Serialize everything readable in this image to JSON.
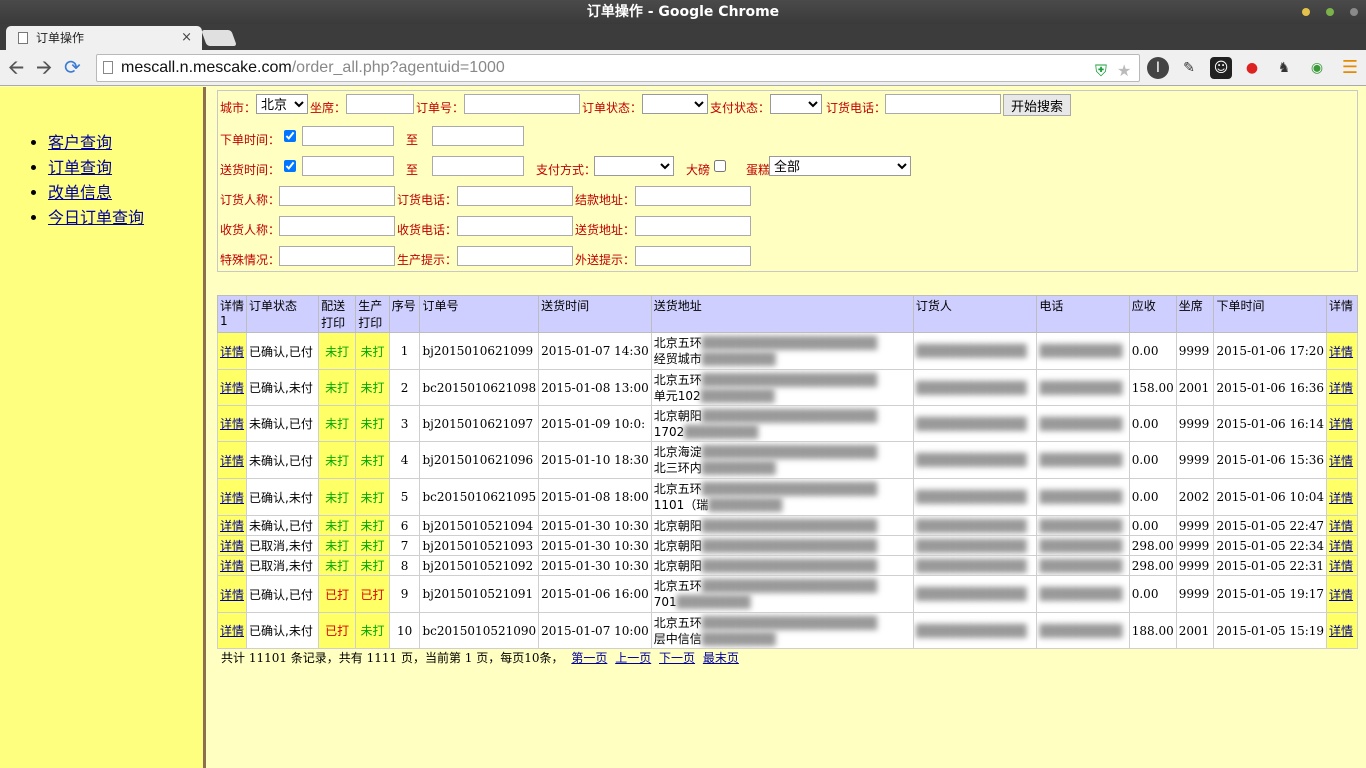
{
  "window": {
    "title": "订单操作 - Google Chrome"
  },
  "tab": {
    "title": "订单操作",
    "close": "×"
  },
  "address": {
    "host": "mescall.n.mescake.com",
    "path": "/order_all.php?agentuid=1000"
  },
  "sidebar": {
    "items": [
      {
        "label": "客户查询"
      },
      {
        "label": "订单查询"
      },
      {
        "label": "改单信息"
      },
      {
        "label": "今日订单查询"
      }
    ]
  },
  "search": {
    "city_label": "城市：",
    "city_value": "北京",
    "seat_label": "坐席：",
    "order_no_label": "订单号：",
    "order_status_label": "订单状态：",
    "pay_status_label": "支付状态：",
    "order_phone_label": "订货电话：",
    "search_button": "开始搜索",
    "order_time_label": "下单时间：",
    "to_label": "至",
    "delivery_time_label": "送货时间：",
    "pay_method_label": "支付方式：",
    "large_label": "大磅",
    "cake_label": "蛋糕",
    "cake_value": "全部",
    "orderer_name_label": "订货人称：",
    "orderer_phone_label": "订货电话：",
    "billing_addr_label": "结款地址：",
    "receiver_name_label": "收货人称：",
    "receiver_phone_label": "收货电话：",
    "delivery_addr_label": "送货地址：",
    "special_label": "特殊情况：",
    "production_label": "生产提示：",
    "outbound_label": "外送提示："
  },
  "table": {
    "headers": {
      "detail1": "详情1",
      "status": "订单状态",
      "dispatch_print": "配送打印",
      "prod_print": "生产打印",
      "seq": "序号",
      "order_no": "订单号",
      "delivery_time": "送货时间",
      "address": "送货地址",
      "orderer": "订货人",
      "phone": "电话",
      "amount": "应收",
      "seat": "坐席",
      "order_time": "下单时间",
      "detail2": "详情"
    },
    "detail_label": "详情",
    "rows": [
      {
        "status": "已确认,已付",
        "dp": "未打",
        "pp": "未打",
        "seq": "1",
        "no": "bj2015010621099",
        "dt": "2015-01-07 14:30",
        "addr1": "北京五环",
        "addr2": "经贸城市",
        "amt": "0.00",
        "seat": "9999",
        "ot": "2015-01-06 17:20"
      },
      {
        "status": "已确认,未付",
        "dp": "未打",
        "pp": "未打",
        "seq": "2",
        "no": "bc2015010621098",
        "dt": "2015-01-08 13:00",
        "addr1": "北京五环",
        "addr2": "单元102",
        "amt": "158.00",
        "seat": "2001",
        "ot": "2015-01-06 16:36"
      },
      {
        "status": "未确认,已付",
        "dp": "未打",
        "pp": "未打",
        "seq": "3",
        "no": "bj2015010621097",
        "dt": "2015-01-09 10:0:",
        "addr1": "北京朝阳",
        "addr2": "1702",
        "amt": "0.00",
        "seat": "9999",
        "ot": "2015-01-06 16:14"
      },
      {
        "status": "未确认,已付",
        "dp": "未打",
        "pp": "未打",
        "seq": "4",
        "no": "bj2015010621096",
        "dt": "2015-01-10 18:30",
        "addr1": "北京海淀",
        "addr2": "北三环内",
        "amt": "0.00",
        "seat": "9999",
        "ot": "2015-01-06 15:36"
      },
      {
        "status": "已确认,未付",
        "dp": "未打",
        "pp": "未打",
        "seq": "5",
        "no": "bc2015010621095",
        "dt": "2015-01-08 18:00",
        "addr1": "北京五环",
        "addr2": "1101（瑞",
        "amt": "0.00",
        "seat": "2002",
        "ot": "2015-01-06 10:04"
      },
      {
        "status": "未确认,已付",
        "dp": "未打",
        "pp": "未打",
        "seq": "6",
        "no": "bj2015010521094",
        "dt": "2015-01-30 10:30",
        "addr1": "北京朝阳",
        "addr2": "",
        "amt": "0.00",
        "seat": "9999",
        "ot": "2015-01-05 22:47"
      },
      {
        "status": "已取消,未付",
        "dp": "未打",
        "pp": "未打",
        "seq": "7",
        "no": "bj2015010521093",
        "dt": "2015-01-30 10:30",
        "addr1": "北京朝阳",
        "addr2": "",
        "amt": "298.00",
        "seat": "9999",
        "ot": "2015-01-05 22:34"
      },
      {
        "status": "已取消,未付",
        "dp": "未打",
        "pp": "未打",
        "seq": "8",
        "no": "bj2015010521092",
        "dt": "2015-01-30 10:30",
        "addr1": "北京朝阳",
        "addr2": "",
        "amt": "298.00",
        "seat": "9999",
        "ot": "2015-01-05 22:31"
      },
      {
        "status": "已确认,已付",
        "dp": "已打",
        "pp": "已打",
        "seq": "9",
        "no": "bj2015010521091",
        "dt": "2015-01-06 16:00",
        "addr1": "北京五环",
        "addr2": "701",
        "amt": "0.00",
        "seat": "9999",
        "ot": "2015-01-05 19:17"
      },
      {
        "status": "已确认,未付",
        "dp": "已打",
        "pp": "未打",
        "seq": "10",
        "no": "bc2015010521090",
        "dt": "2015-01-07 10:00",
        "addr1": "北京五环",
        "addr2": "层中信信",
        "amt": "188.00",
        "seat": "2001",
        "ot": "2015-01-05 15:19"
      }
    ]
  },
  "footer": {
    "summary": "共计 11101 条记录，共有 1111 页，当前第 1 页，每页10条，",
    "first": "第一页",
    "prev": "上一页",
    "next": "下一页",
    "last": "最末页"
  },
  "colors": {
    "printed_no": "#00aa00",
    "printed_yes": "#dd0000",
    "link": "#00009c",
    "label": "#c00000"
  }
}
